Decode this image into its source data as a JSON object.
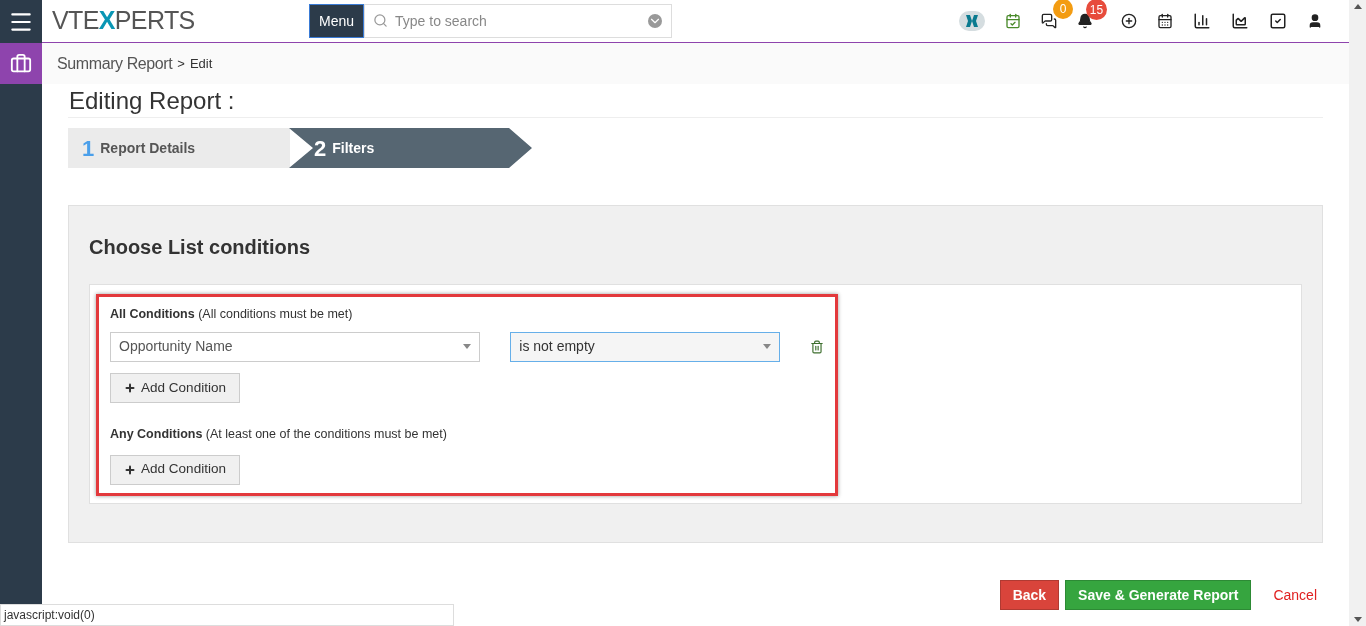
{
  "header": {
    "logo_left": "VTE",
    "logo_mark": "X",
    "logo_right": "PERTS",
    "menu_button": "Menu",
    "search": {
      "placeholder": "Type to search"
    },
    "chat_badge": "0",
    "notification_badge": "15"
  },
  "breadcrumb": {
    "module": "Summary Report",
    "separator": ">",
    "page": "Edit"
  },
  "page_title": "Editing Report :",
  "steps": [
    {
      "number": "1",
      "label": "Report Details",
      "selected": false
    },
    {
      "number": "2",
      "label": "Filters",
      "selected": true
    }
  ],
  "panel_title": "Choose List conditions",
  "groups": [
    {
      "title": "All Conditions",
      "hint": "(All conditions must be met)",
      "conditions": [
        {
          "field": "Opportunity Name",
          "operator": "is not empty",
          "focused": true
        }
      ],
      "add_button": "Add Condition"
    },
    {
      "title": "Any Conditions",
      "hint": "(At least one of the conditions must be met)",
      "add_button": "Add Condition"
    }
  ],
  "buttons": {
    "back": "Back",
    "save": "Save & Generate Report",
    "cancel": "Cancel"
  },
  "status_bar": "javascript:void(0)"
}
